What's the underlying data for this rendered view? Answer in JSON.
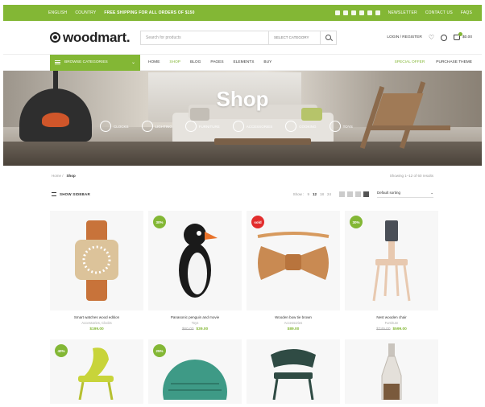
{
  "topbar": {
    "lang": "ENGLISH",
    "currency": "COUNTRY",
    "promo": "FREE SHIPPING FOR ALL ORDERS OF $150",
    "newsletter": "NEWSLETTER",
    "contact": "CONTACT US",
    "faqs": "FAQS"
  },
  "header": {
    "logo": "woodmart.",
    "search_placeholder": "Search for products",
    "search_category": "SELECT CATEGORY",
    "login": "LOGIN / REGISTER",
    "cart_total": "$0.00"
  },
  "nav": {
    "browse": "BROWSE CATEGORIES",
    "items": [
      "HOME",
      "SHOP",
      "BLOG",
      "PAGES",
      "ELEMENTS",
      "BUY"
    ],
    "special": "SPECIAL OFFER",
    "theme": "PURCHASE THEME"
  },
  "hero": {
    "title": "Shop",
    "categories": [
      "CLOCKS",
      "LIGHTING",
      "FURNITURE",
      "ACCESSORIES",
      "COOKING",
      "TOYS"
    ]
  },
  "breadcrumb": {
    "home": "Home",
    "current": "Shop",
    "results": "Showing 1–12 of 60 results"
  },
  "toolbar": {
    "filter": "SHOW SIDEBAR",
    "show_label": "Show :",
    "show_options": [
      "9",
      "12",
      "18",
      "24"
    ],
    "sort": "Default sorting"
  },
  "products": [
    {
      "label": "",
      "name": "Smart watches wood edition",
      "category": "Accessories, Clocks",
      "old_price": "",
      "price": "$199.00"
    },
    {
      "label": "30%",
      "name": "Panasonic penguin and movie",
      "category": "Toys",
      "old_price": "$60.00",
      "price": "$39.00"
    },
    {
      "label": "sold",
      "name": "Wooden bow tie brown",
      "category": "Accessories",
      "old_price": "",
      "price": "$89.00"
    },
    {
      "label": "30%",
      "name": "Nest wooden chair",
      "category": "Furniture",
      "old_price": "$749.00",
      "price": "$599.00"
    },
    {
      "label": "40%",
      "name": "",
      "category": "",
      "old_price": "",
      "price": ""
    },
    {
      "label": "25%",
      "name": "",
      "category": "",
      "old_price": "",
      "price": ""
    },
    {
      "label": "",
      "name": "",
      "category": "",
      "old_price": "",
      "price": ""
    },
    {
      "label": "",
      "name": "",
      "category": "",
      "old_price": "",
      "price": ""
    }
  ],
  "colors": {
    "accent": "#83b735",
    "sale": "#e22d2d"
  }
}
